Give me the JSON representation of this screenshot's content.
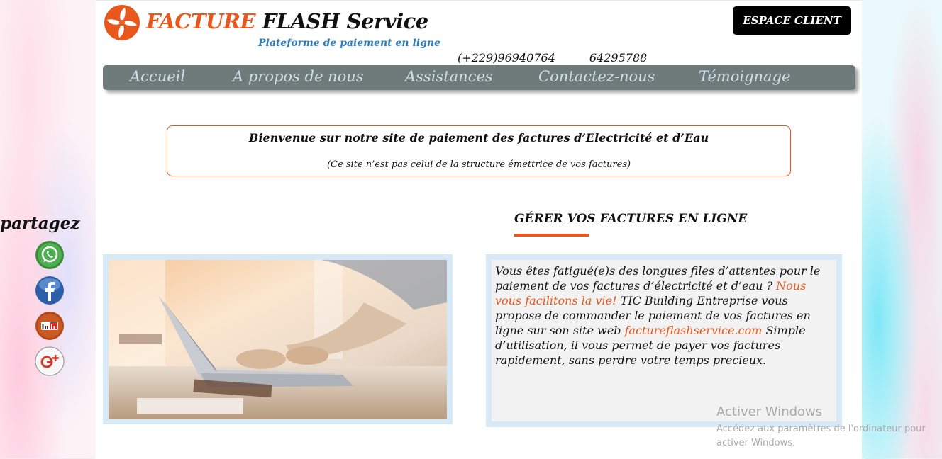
{
  "header": {
    "brand_part1": "FACTURE",
    "brand_part2": "FLASH Service",
    "tagline": "Plateforme de paiement en ligne",
    "phone1": "(+229)96940764",
    "phone2": "64295788",
    "espace_client": "ESPACE CLIENT"
  },
  "nav": {
    "items": [
      {
        "label": "Accueil"
      },
      {
        "label": "A propos de nous"
      },
      {
        "label": "Assistances"
      },
      {
        "label": "Contactez-nous"
      },
      {
        "label": "Témoignage"
      }
    ]
  },
  "welcome": {
    "title": "Bienvenue sur notre site de paiement des factures d’Electricité et d’Eau",
    "subtitle": "(Ce site n’est pas celui de la structure émettrice de vos factures)"
  },
  "section": {
    "heading": "GÉRER VOS FACTURES EN LIGNE",
    "text_part1": "Vous êtes fatigué(e)s des longues files d’attentes pour le paiement de vos factures d’électricité et d’eau ? ",
    "text_highlight1": "Nous vous facilitons la vie!",
    "text_part2": " TIC Building Entreprise vous propose de commander le paiement de vos factures en ligne sur son site web ",
    "text_highlight2": "factureflashservice.com",
    "text_part3": " Simple d’utilisation, il vous permet de payer vos factures rapidement, sans perdre votre temps precieux."
  },
  "share": {
    "label": "partagez",
    "icons": [
      "whatsapp-icon",
      "facebook-icon",
      "youtube-icon",
      "google-plus-icon"
    ]
  },
  "windows_watermark": {
    "title": "Activer Windows",
    "text": "Accédez aux paramètres de l'ordinateur pour activer Windows."
  },
  "colors": {
    "accent": "#e8571c",
    "nav_bg": "#6f7a7b",
    "tagline": "#2e7dbf",
    "box_bg": "#d7e8f6"
  }
}
